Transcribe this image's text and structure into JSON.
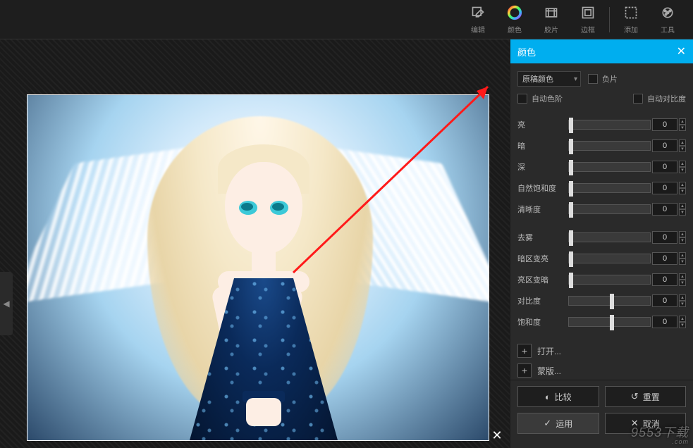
{
  "toolbar": {
    "items": [
      {
        "icon": "edit-icon",
        "label": "编辑"
      },
      {
        "icon": "color-icon",
        "label": "颜色"
      },
      {
        "icon": "film-icon",
        "label": "胶片"
      },
      {
        "icon": "frame-icon",
        "label": "边框"
      },
      {
        "icon": "add-icon",
        "label": "添加"
      },
      {
        "icon": "tools-icon",
        "label": "工具"
      }
    ]
  },
  "panel": {
    "title": "颜色",
    "preset_label": "原稿颜色",
    "negative_label": "负片",
    "auto_tone_label": "自动色阶",
    "auto_contrast_label": "自动对比度",
    "sliders_a": [
      {
        "label": "亮",
        "value": "0"
      },
      {
        "label": "暗",
        "value": "0"
      },
      {
        "label": "深",
        "value": "0"
      },
      {
        "label": "自然饱和度",
        "value": "0"
      },
      {
        "label": "清晰度",
        "value": "0"
      }
    ],
    "sliders_b": [
      {
        "label": "去雾",
        "value": "0"
      },
      {
        "label": "暗区变亮",
        "value": "0"
      },
      {
        "label": "亮区变暗",
        "value": "0"
      },
      {
        "label": "对比度",
        "value": "0",
        "mid": true
      },
      {
        "label": "饱和度",
        "value": "0",
        "mid": true
      }
    ],
    "open_label": "打开...",
    "mask_label": "蒙版...",
    "compare_label": "比较",
    "reset_label": "重置",
    "apply_label": "运用",
    "cancel_label": "取消"
  },
  "watermark": {
    "text": "9553下载",
    "sub": ".com"
  }
}
